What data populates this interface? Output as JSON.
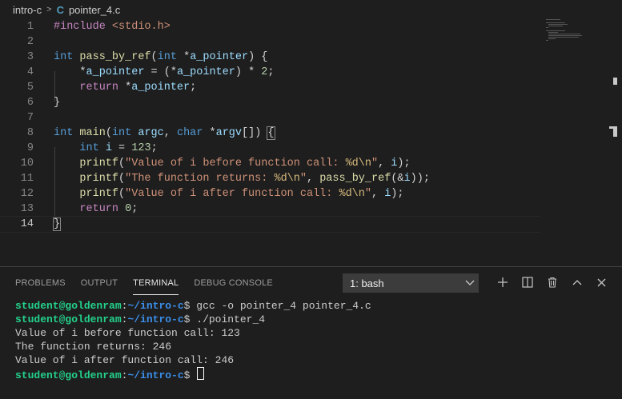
{
  "breadcrumb": {
    "folder": "intro-c",
    "separator": ">",
    "file_icon": "C",
    "file": "pointer_4.c"
  },
  "editor": {
    "current_line": 14,
    "line_numbers": [
      "1",
      "2",
      "3",
      "4",
      "5",
      "6",
      "7",
      "8",
      "9",
      "10",
      "11",
      "12",
      "13",
      "14"
    ]
  },
  "panel": {
    "tabs": [
      "PROBLEMS",
      "OUTPUT",
      "TERMINAL",
      "DEBUG CONSOLE"
    ],
    "active_tab": "TERMINAL",
    "terminal_select": "1: bash",
    "actions": [
      "plus-icon",
      "split-icon",
      "trash-icon",
      "chevron-up-icon",
      "close-icon"
    ]
  },
  "terminal": {
    "prompt_user": "student@goldenram",
    "prompt_sep": ":",
    "prompt_path": "~/intro-c",
    "prompt_end": "$ ",
    "cmd1": "gcc -o pointer_4 pointer_4.c",
    "cmd2": "./pointer_4",
    "out1": "Value of i before function call: 123",
    "out2": "The function returns: 246",
    "out3": "Value of i after function call: 246"
  },
  "colors": {
    "background": "#1e1e1e",
    "prompt_user": "#23d18b",
    "prompt_path": "#3b8eea"
  }
}
